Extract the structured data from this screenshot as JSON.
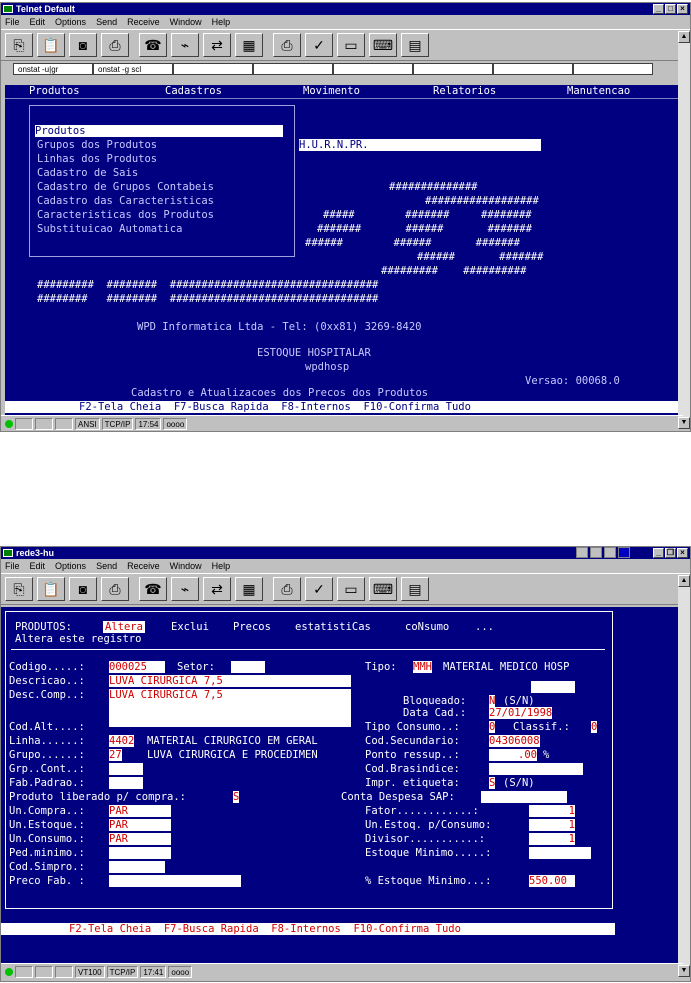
{
  "window1": {
    "title": "Telnet Default",
    "menu": [
      "File",
      "Edit",
      "Options",
      "Send",
      "Receive",
      "Window",
      "Help"
    ],
    "tabs": [
      "onstat -u|gr",
      "onstat -g scl",
      "",
      "",
      "",
      "",
      "",
      ""
    ],
    "menubar_items": [
      "Produtos",
      "Cadastros",
      "Movimento",
      "Relatorios",
      "Manutencao"
    ],
    "menu_items": [
      "Produtos",
      "Grupos dos Produtos",
      "Linhas dos Produtos",
      "Cadastro de Sais",
      "Cadastro de Grupos Contabeis",
      "Cadastro das Caracteristicas",
      "Caracteristicas dos Produtos",
      "Substituicao Automatica"
    ],
    "hospital_field": "H.U.R.N.PR.",
    "art_lines": [
      "##############",
      "##################",
      "#####        #######     ########",
      "#######       ######       #######",
      "######        ######       #######",
      "######       #######",
      "#########    ##########",
      "#########  ########  #################################",
      "########   ########  #################################"
    ],
    "company": "WPD Informatica Ltda - Tel: (0xx81) 3269-8420",
    "system": "ESTOQUE HOSPITALAR",
    "program": "wpdhosp",
    "version": "Versao: 00068.0",
    "description": "Cadastro e Atualizacoes dos Precos dos Produtos",
    "fkeys": "F2-Tela Cheia  F7-Busca Rapida  F8-Internos  F10-Confirma Tudo",
    "status": {
      "mode": "ANSI",
      "proto": "TCP/IP",
      "time": "17:54",
      "box": "oooo"
    }
  },
  "window2": {
    "title": "rede3-hu",
    "menu": [
      "File",
      "Edit",
      "Options",
      "Send",
      "Receive",
      "Window",
      "Help"
    ],
    "header_label": "PRODUTOS:",
    "actions": [
      "Altera",
      "Exclui",
      "Precos",
      "estatistiCas",
      "coNsumo",
      "..."
    ],
    "subtitle": "Altera este registro",
    "fields": {
      "codigo_label": "Codigo.....:",
      "codigo": "000025",
      "setor_label": "Setor:",
      "tipo_label": "Tipo:",
      "tipo_code": "MMH",
      "tipo_desc": "MATERIAL MEDICO HOSP",
      "descricao_label": "Descricao..:",
      "descricao": "LUVA CIRURGICA 7,5",
      "desc_comp_label": "Desc.Comp..:",
      "desc_comp": "LUVA CIRURGICA 7,5",
      "bloqueado_label": "Bloqueado:",
      "bloqueado": "N",
      "bloqueado_hint": "(S/N)",
      "data_cad_label": "Data Cad.:",
      "data_cad": "27/01/1998",
      "cod_alt_label": "Cod.Alt....:",
      "tipo_consumo_label": "Tipo Consumo..:",
      "tipo_consumo": "0",
      "classif_label": "Classif.:",
      "classif": "0",
      "linha_label": "Linha......:",
      "linha_code": "4402",
      "linha_desc": "MATERIAL CIRURGICO EM GERAL",
      "cod_sec_label": "Cod.Secundario:",
      "cod_sec": "04306008",
      "grupo_label": "Grupo......:",
      "grupo_code": "27",
      "grupo_desc": "LUVA CIRURGICA E PROCEDIMEN",
      "ponto_label": "Ponto ressup..:",
      "ponto": ".00",
      "ponto_unit": "%",
      "grp_cont_label": "Grp..Cont..:",
      "cod_bras_label": "Cod.Brasindice:",
      "fab_label": "Fab.Padrao.:",
      "impr_label": "Impr. etiqueta:",
      "impr": "S",
      "impr_hint": "(S/N)",
      "liberado_label": "Produto liberado p/ compra.:",
      "liberado": "S",
      "conta_label": "Conta Despesa SAP:",
      "un_compra_label": "Un.Compra..:",
      "un_compra": "PAR",
      "fator_label": "Fator............:",
      "fator": "1",
      "un_estoque_label": "Un.Estoque.:",
      "un_estoque": "PAR",
      "un_estq_label": "Un.Estoq. p/Consumo:",
      "un_estq": "1",
      "un_consumo_label": "Un.Consumo.:",
      "un_consumo": "PAR",
      "divisor_label": "Divisor...........:",
      "divisor": "1",
      "ped_min_label": "Ped.minimo.:",
      "estoque_min_label": "Estoque Minimo.....:",
      "cod_simpro_label": "Cod.Simpro.:",
      "preco_label": "Preco Fab. :",
      "pct_label": "% Estoque Minimo...:",
      "pct": "550.00"
    },
    "fkeys": "F2-Tela Cheia  F7-Busca Rapida  F8-Internos  F10-Confirma Tudo",
    "status": {
      "mode": "VT100",
      "proto": "TCP/IP",
      "time": "17:41",
      "box": "oooo"
    }
  }
}
